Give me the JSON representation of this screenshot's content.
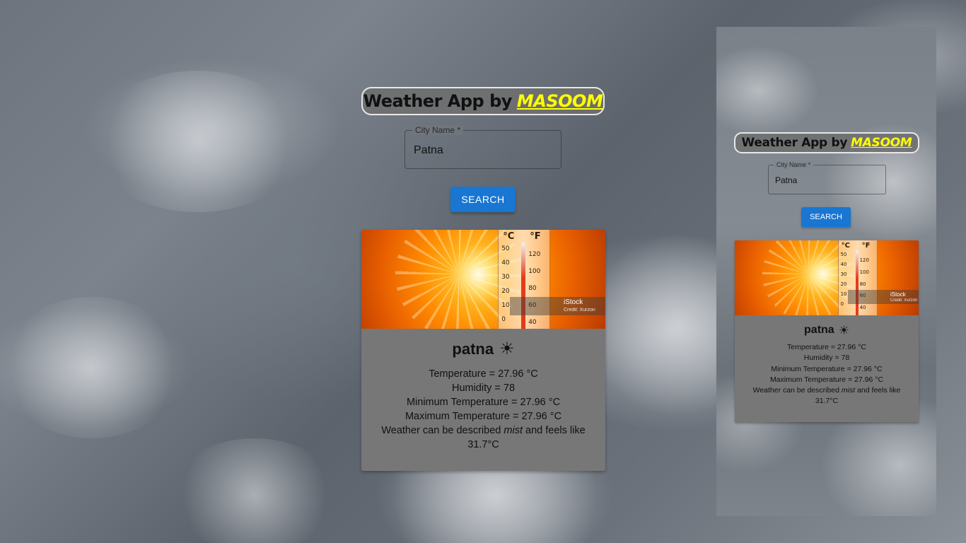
{
  "app": {
    "title_prefix": "Weather App by",
    "brand": "MASOOM"
  },
  "search": {
    "label": "City Name",
    "required_mark": "*",
    "value": "Patna",
    "button": "SEARCH"
  },
  "result": {
    "city": "patna",
    "icon": "sun-icon",
    "icon_glyph": "☀",
    "temperature": "Temperature = 27.96 °C",
    "humidity": "Humidity = 78",
    "min_temp": "Minimum Temperature = 27.96 °C",
    "max_temp": "Maximum Temperature = 27.96 °C",
    "desc_prefix": "Weather can be described",
    "desc_word": "mist",
    "desc_suffix": "and feels like 31.7°C"
  },
  "image": {
    "unit_c": "°C",
    "unit_f": "°F",
    "watermark": "iStock",
    "watermark_credit": "Credit: Xurzon"
  },
  "colors": {
    "brand_yellow": "#ffff00",
    "button_blue": "#1976d2",
    "card_gray": "#777777"
  }
}
